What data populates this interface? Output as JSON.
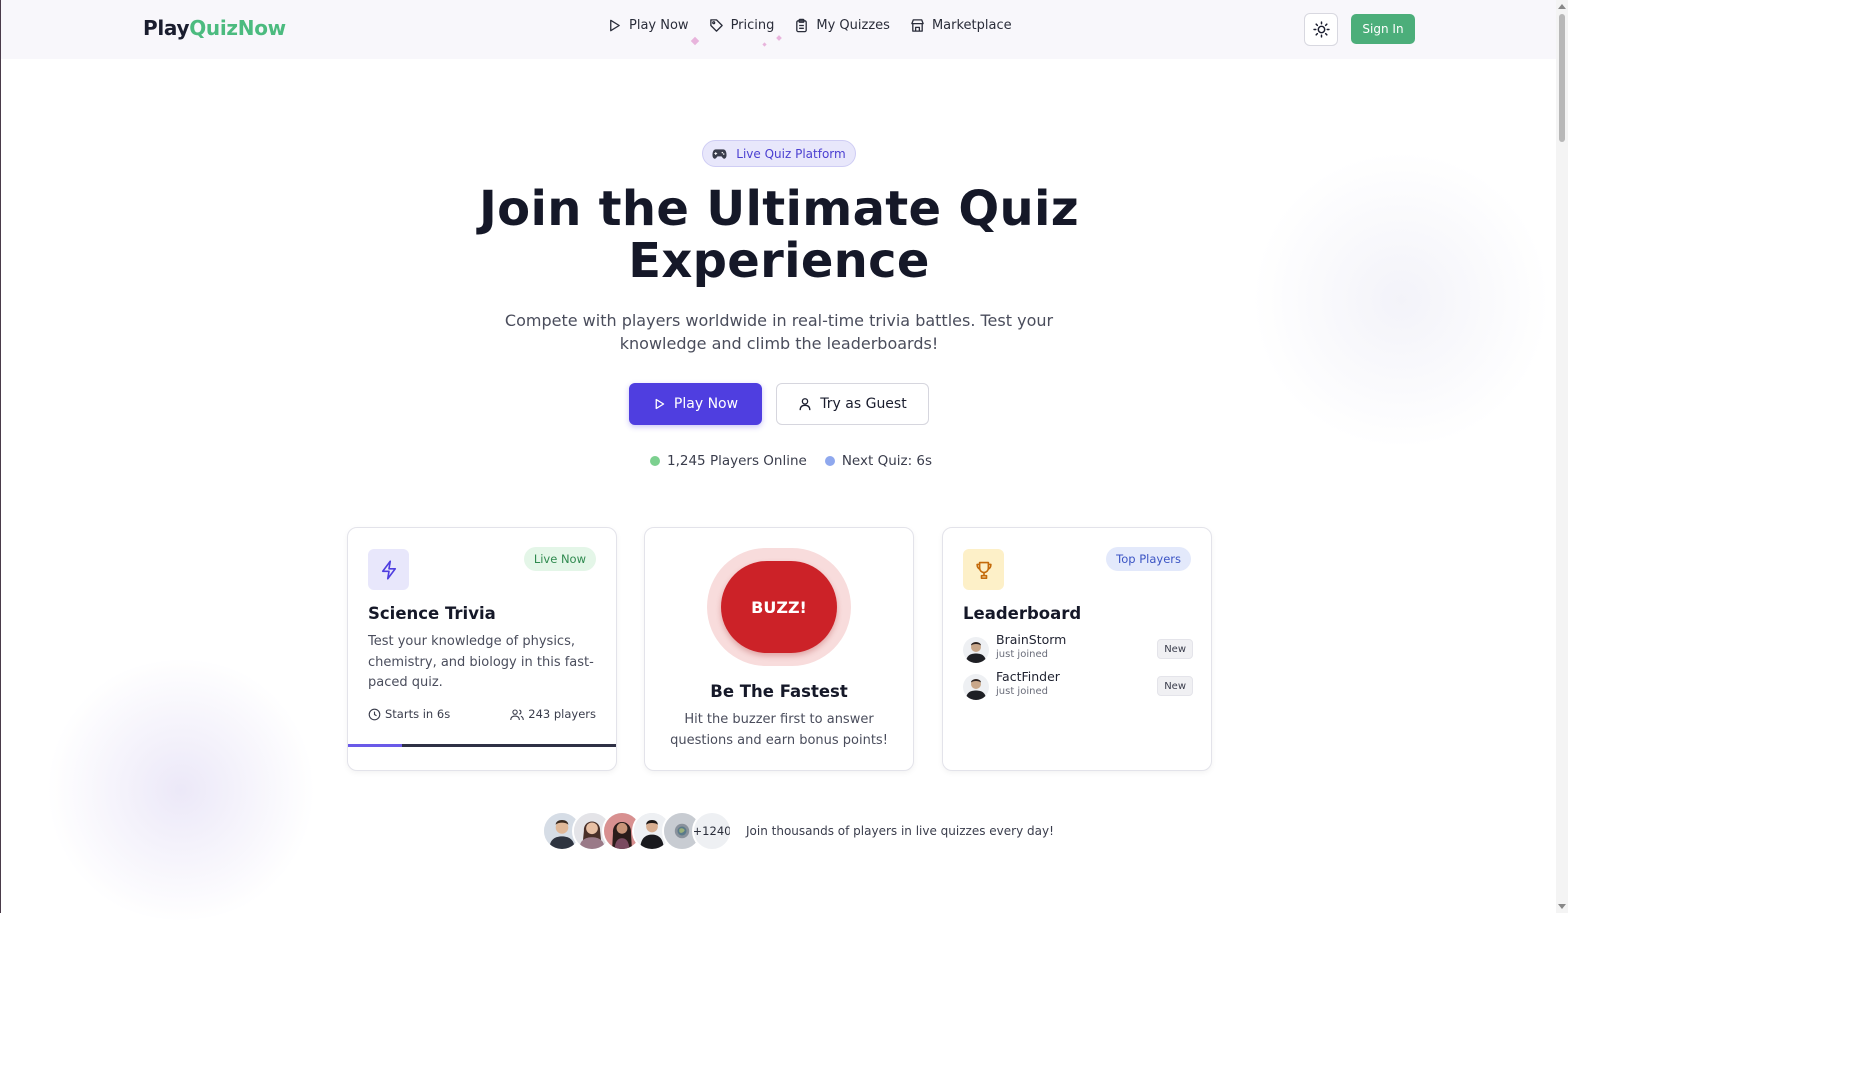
{
  "header": {
    "logo_part1": "Play",
    "logo_part2": "QuizNow",
    "nav": [
      {
        "label": "Play Now",
        "icon": "play-icon"
      },
      {
        "label": "Pricing",
        "icon": "tag-icon"
      },
      {
        "label": "My Quizzes",
        "icon": "clipboard-icon"
      },
      {
        "label": "Marketplace",
        "icon": "store-icon"
      }
    ],
    "theme_icon": "sun-icon",
    "signin_label": "Sign In"
  },
  "hero": {
    "badge_icon": "gamepad-icon",
    "badge_label": "Live Quiz Platform",
    "title_line1": "Join the Ultimate Quiz",
    "title_line2": "Experience",
    "subtitle": "Compete with players worldwide in real-time trivia battles. Test your knowledge and climb the leaderboards!",
    "play_label": "Play Now",
    "guest_label": "Try as Guest",
    "players_online": "1,245 Players Online",
    "next_quiz": "Next Quiz: 6s"
  },
  "cards": {
    "science": {
      "icon": "lightning-icon",
      "badge": "Live Now",
      "title": "Science Trivia",
      "description": "Test your knowledge of physics, chemistry, and biology in this fast-paced quiz.",
      "starts": "Starts in 6s",
      "players": "243 players",
      "progress_fraction": 0.2
    },
    "buzzer": {
      "button_label": "BUZZ!",
      "title": "Be The Fastest",
      "description": "Hit the buzzer first to answer questions and earn bonus points!"
    },
    "leaderboard": {
      "icon": "trophy-icon",
      "badge": "Top Players",
      "title": "Leaderboard",
      "entries": [
        {
          "name": "BrainStorm",
          "sub": "just joined",
          "tag": "New"
        },
        {
          "name": "FactFinder",
          "sub": "just joined",
          "tag": "New"
        }
      ]
    }
  },
  "social": {
    "extra_count": "+1240",
    "text": "Join thousands of players in live quizzes every day!"
  },
  "colors": {
    "brand_green": "#4cbb7f",
    "primary": "#4f3ee0",
    "buzz_red": "#cc2228"
  }
}
